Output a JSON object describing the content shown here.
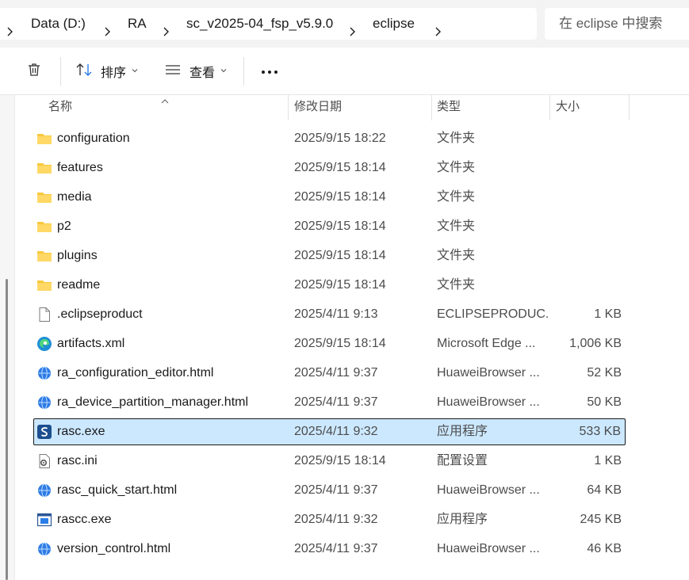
{
  "address": {
    "crumbs": [
      "Data (D:)",
      "RA",
      "sc_v2025-04_fsp_v5.9.0",
      "eclipse"
    ],
    "search_placeholder": "在 eclipse 中搜索"
  },
  "toolbar": {
    "sort_label": "排序",
    "view_label": "查看"
  },
  "columns": {
    "name": "名称",
    "date": "修改日期",
    "type": "类型",
    "size": "大小"
  },
  "files": [
    {
      "name": "configuration",
      "date": "2025/9/15 18:22",
      "type": "文件夹",
      "size": "",
      "icon": "folder-icon"
    },
    {
      "name": "features",
      "date": "2025/9/15 18:14",
      "type": "文件夹",
      "size": "",
      "icon": "folder-icon"
    },
    {
      "name": "media",
      "date": "2025/9/15 18:14",
      "type": "文件夹",
      "size": "",
      "icon": "folder-icon"
    },
    {
      "name": "p2",
      "date": "2025/9/15 18:14",
      "type": "文件夹",
      "size": "",
      "icon": "folder-icon"
    },
    {
      "name": "plugins",
      "date": "2025/9/15 18:14",
      "type": "文件夹",
      "size": "",
      "icon": "folder-icon"
    },
    {
      "name": "readme",
      "date": "2025/9/15 18:14",
      "type": "文件夹",
      "size": "",
      "icon": "folder-icon"
    },
    {
      "name": ".eclipseproduct",
      "date": "2025/4/11 9:13",
      "type": "ECLIPSEPRODUC...",
      "size": "1 KB",
      "icon": "file-icon"
    },
    {
      "name": "artifacts.xml",
      "date": "2025/9/15 18:14",
      "type": "Microsoft Edge ...",
      "size": "1,006 KB",
      "icon": "edge-icon"
    },
    {
      "name": "ra_configuration_editor.html",
      "date": "2025/4/11 9:37",
      "type": "HuaweiBrowser ...",
      "size": "52 KB",
      "icon": "browser-icon"
    },
    {
      "name": "ra_device_partition_manager.html",
      "date": "2025/4/11 9:37",
      "type": "HuaweiBrowser ...",
      "size": "50 KB",
      "icon": "browser-icon"
    },
    {
      "name": "rasc.exe",
      "date": "2025/4/11 9:32",
      "type": "应用程序",
      "size": "533 KB",
      "icon": "app-icon",
      "selected": true
    },
    {
      "name": "rasc.ini",
      "date": "2025/9/15 18:14",
      "type": "配置设置",
      "size": "1 KB",
      "icon": "settings-file-icon"
    },
    {
      "name": "rasc_quick_start.html",
      "date": "2025/4/11 9:37",
      "type": "HuaweiBrowser ...",
      "size": "64 KB",
      "icon": "browser-icon"
    },
    {
      "name": "rascc.exe",
      "date": "2025/4/11 9:32",
      "type": "应用程序",
      "size": "245 KB",
      "icon": "window-app-icon"
    },
    {
      "name": "version_control.html",
      "date": "2025/4/11 9:37",
      "type": "HuaweiBrowser ...",
      "size": "46 KB",
      "icon": "browser-icon"
    }
  ],
  "colors": {
    "selection": "#cce8ff",
    "folder": "#f8c83c",
    "accent": "#2b7de9"
  }
}
